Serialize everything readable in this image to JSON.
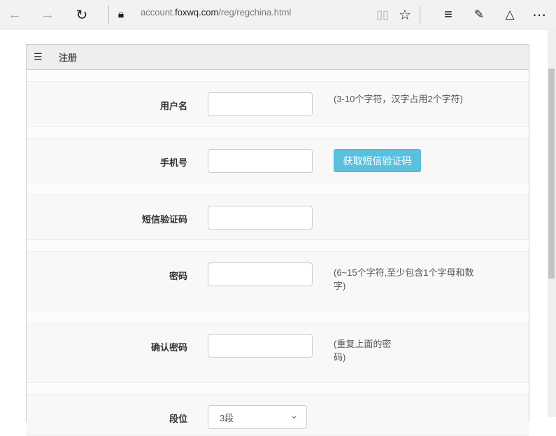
{
  "browser": {
    "url_prefix": "account.",
    "url_domain": "foxwq.com",
    "url_path": "/reg/regchina.html"
  },
  "panel": {
    "title": "注册"
  },
  "form": {
    "username": {
      "label": "用户名",
      "hint": "(3-10个字符，汉字占用2个字符)"
    },
    "phone": {
      "label": "手机号",
      "button": "获取短信验证码"
    },
    "sms": {
      "label": "短信验证码"
    },
    "password": {
      "label": "密码",
      "hint": "(6~15个字符,至少包含1个字母和数字)"
    },
    "confirm": {
      "label": "确认密码",
      "hint": "(重复上面的密码)"
    },
    "rank": {
      "label": "段位",
      "value": "3段"
    }
  }
}
